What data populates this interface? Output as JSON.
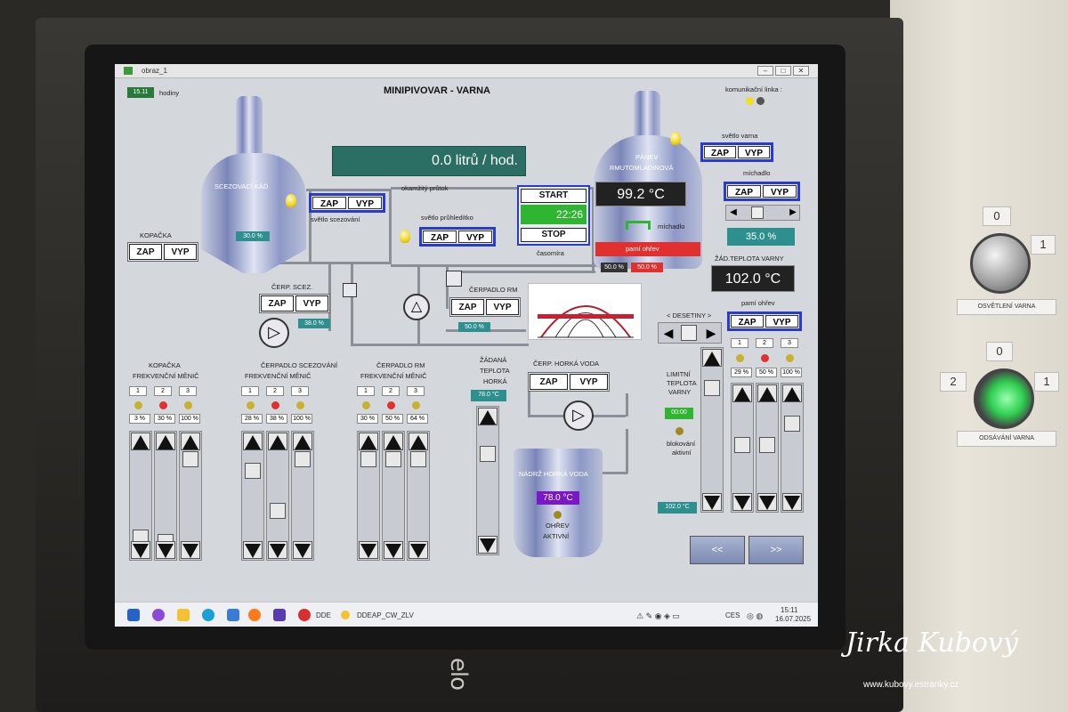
{
  "window": {
    "icon": "app-icon",
    "title": "obraz_1"
  },
  "header": {
    "time": "15.11",
    "time_label": "hodiny",
    "title": "MINIPIVOVAR -  VARNA",
    "comm_label": "komunikační linka :"
  },
  "flow": {
    "value": "0.0   litrů / hod.",
    "label": "okamžitý průtok"
  },
  "timer": {
    "start": "START",
    "time": "22:26",
    "stop": "STOP",
    "label": "časomíra"
  },
  "scezovaci": {
    "title": "SCEZOVACÍ KÁĎ",
    "value": "30.0 %",
    "light_label": "světlo scezování"
  },
  "panev": {
    "title1": "PÁNEV",
    "title2": "RMUTOMLADINOVÁ",
    "temp": "99.2 °C",
    "mix_label": "míchadlo",
    "heat_label": "pamí ohřev",
    "val1": "50.0 %",
    "val2": "50.0 %"
  },
  "controls": {
    "zap": "ZAP",
    "vyp": "VYP"
  },
  "lights": {
    "pruhledítko": "světlo průhledítko",
    "varna": "světlo varna"
  },
  "kopacka": {
    "label": "KOPAČKA"
  },
  "cerp_scez": {
    "label": "ČERP. SCEZ.",
    "value": "38.0 %"
  },
  "cerpadlo_rm": {
    "label": "ČERPADLO RM",
    "value": "50.0 %"
  },
  "right_panel": {
    "michadlo": "míchadlo",
    "mix_value": "35.0 %",
    "zad_label": "ŽÁD.TEPLOTA VARNY",
    "zad_temp": "102.0 °C",
    "ohrev_label": "pamí ohřev",
    "desetiny": "< DESETINY >",
    "nums": [
      "1",
      "2",
      "3"
    ],
    "pcts": [
      "29 %",
      "50 %",
      "100 %"
    ]
  },
  "limit": {
    "label1": "LIMITNÍ",
    "label2": "TEPLOTA",
    "label3": "VARNY",
    "time": "00:00",
    "blok1": "blokování",
    "blok2": "aktivní",
    "value": "102.0 °C"
  },
  "nav": {
    "prev": "<<",
    "next": ">>"
  },
  "freq": [
    {
      "title1": "KOPAČKA",
      "title2": "FREKVENČNÍ MĚNIČ",
      "nums": [
        "1",
        "2",
        "3"
      ],
      "pcts": [
        "3 %",
        "30 %",
        "100 %"
      ]
    },
    {
      "title1": "ČERPADLO SCEZOVÁNÍ",
      "title2": "FREKVENČNÍ MĚNIČ",
      "nums": [
        "1",
        "2",
        "3"
      ],
      "pcts": [
        "28 %",
        "38 %",
        "100 %"
      ]
    },
    {
      "title1": "ČERPADLO RM",
      "title2": "FREKVENČNÍ MĚNIČ",
      "nums": [
        "1",
        "2",
        "3"
      ],
      "pcts": [
        "30 %",
        "50 %",
        "64 %"
      ]
    }
  ],
  "horka": {
    "label1": "ŽÁDANÁ",
    "label2": "TEPLOTA",
    "label3": "HORKÁ",
    "temp": "78.0 °C",
    "pump_label": "ČERP. HORKÁ VODA",
    "tank_title": "NÁDRŽ HORKÁ VODA",
    "tank_temp": "78.0 °C",
    "ohrev1": "OHŘEV",
    "ohrev2": "AKTIVNÍ"
  },
  "taskbar": {
    "app1": "DDE",
    "app2": "DDEAP_CW_ZLV",
    "lang": "CES",
    "time": "15:11",
    "date": "16.07.2025"
  },
  "switches": {
    "top_0": "0",
    "top_1": "1",
    "top_plate": "OSVĚTLENÍ VARNA",
    "bot_0": "0",
    "bot_2": "2",
    "bot_1": "1",
    "bot_plate": "ODSÁVÁNÍ VARNA"
  },
  "bezel": {
    "brand": "elo"
  },
  "watermark": {
    "sign": "Jirka Kubový",
    "url": "www.kubovy.estranky.cz"
  },
  "colors": {
    "panel_bg": "#d4d7dc",
    "teal": "#2e8f8f",
    "blue_border": "#2a3ad0",
    "green": "#2fb52f",
    "red": "#e03030",
    "temp_bg": "#222222",
    "purple": "#7a18c8"
  }
}
